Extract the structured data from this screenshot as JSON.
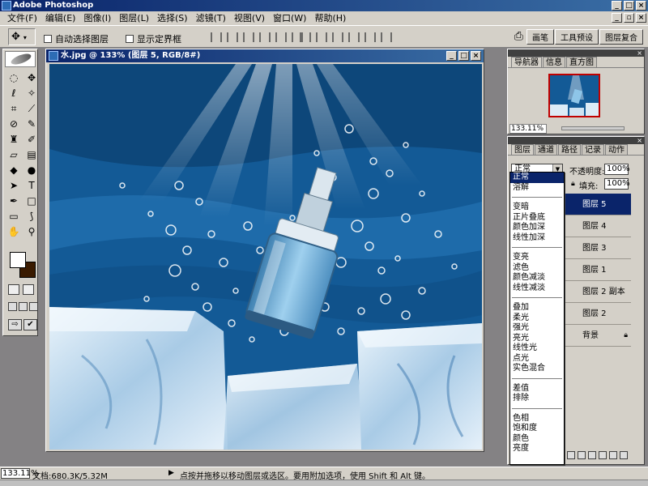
{
  "app": {
    "title": "Adobe Photoshop",
    "window_buttons": [
      "_",
      "□",
      "×"
    ]
  },
  "menu": [
    "文件(F)",
    "编辑(E)",
    "图像(I)",
    "图层(L)",
    "选择(S)",
    "滤镜(T)",
    "视图(V)",
    "窗口(W)",
    "帮助(H)"
  ],
  "menu_buttons": [
    "_",
    "▫",
    "×"
  ],
  "options": {
    "auto_select_label": "自动选择图层",
    "show_bounds_label": "显示定界框",
    "palette_well": [
      "画笔",
      "工具预设",
      "图层复合"
    ]
  },
  "document": {
    "title": "水.jpg @ 133% (图层 5, RGB/8#)",
    "buttons": [
      "_",
      "□",
      "×"
    ]
  },
  "navigator": {
    "tabs": [
      "导航器",
      "信息",
      "直方图"
    ],
    "zoom": "133.11%"
  },
  "layers": {
    "tabs": [
      "图层",
      "通道",
      "路径",
      "记录",
      "动作"
    ],
    "blend_mode": "正常",
    "opacity_label": "不透明度:",
    "opacity": "100%",
    "fill_label": "填充:",
    "fill": "100%",
    "rows": [
      "图层 5",
      "图层 4",
      "图层 3",
      "图层 1",
      "图层 2 副本",
      "图层 2",
      "背景"
    ]
  },
  "blend_dropdown": {
    "groups": [
      [
        "正常",
        "溶解"
      ],
      [
        "变暗",
        "正片叠底",
        "颜色加深",
        "线性加深"
      ],
      [
        "变亮",
        "滤色",
        "颜色减淡",
        "线性减淡"
      ],
      [
        "叠加",
        "柔光",
        "强光",
        "亮光",
        "线性光",
        "点光",
        "实色混合"
      ],
      [
        "差值",
        "排除"
      ],
      [
        "色相",
        "饱和度",
        "颜色",
        "亮度"
      ]
    ],
    "selected": "正常"
  },
  "status": {
    "zoom": "133.11%",
    "doc_size": "文档:680.3K/5.32M",
    "hint": "点按并拖移以移动图层或选区。要用附加选项，使用 Shift 和 Alt 键。"
  },
  "colors": {
    "title_bar": "#0a246a",
    "chrome": "#d4d0c8",
    "workspace": "#848284",
    "selection": "#0a246a",
    "water": "#1a6aa8"
  }
}
